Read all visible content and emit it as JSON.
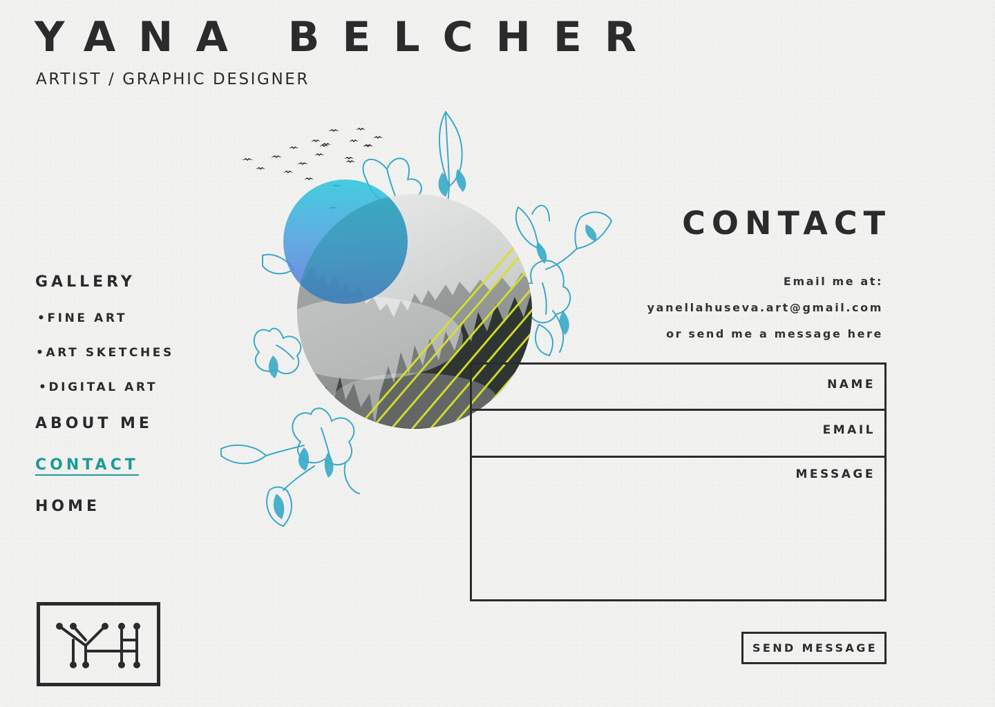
{
  "header": {
    "title": "YANA BELCHER",
    "subtitle": "ARTIST / GRAPHIC DESIGNER"
  },
  "nav": {
    "gallery": "GALLERY",
    "fine_art": "•FINE ART",
    "art_sketches": "•ART SKETCHES",
    "digital_art": "•DIGITAL ART",
    "about": "ABOUT ME",
    "contact": "CONTACT",
    "home": "HOME",
    "active_item": "contact"
  },
  "contact": {
    "title": "CONTACT",
    "email_prompt": "Email me at:",
    "email": "yanellahuseva.art@gmail.com",
    "message_prompt": "or send me a message here"
  },
  "form": {
    "name_label": "NAME",
    "email_label": "EMAIL",
    "message_label": "MESSAGE",
    "name_value": "",
    "email_value": "",
    "message_value": "",
    "submit_label": "SEND MESSAGE"
  },
  "colors": {
    "background": "#f1f1f0",
    "text": "#2b2b2b",
    "accent": "#1c9b96",
    "flower_line": "#3aa9c9",
    "stripe": "#d8e02a"
  },
  "logo": {
    "monogram": "YH"
  }
}
